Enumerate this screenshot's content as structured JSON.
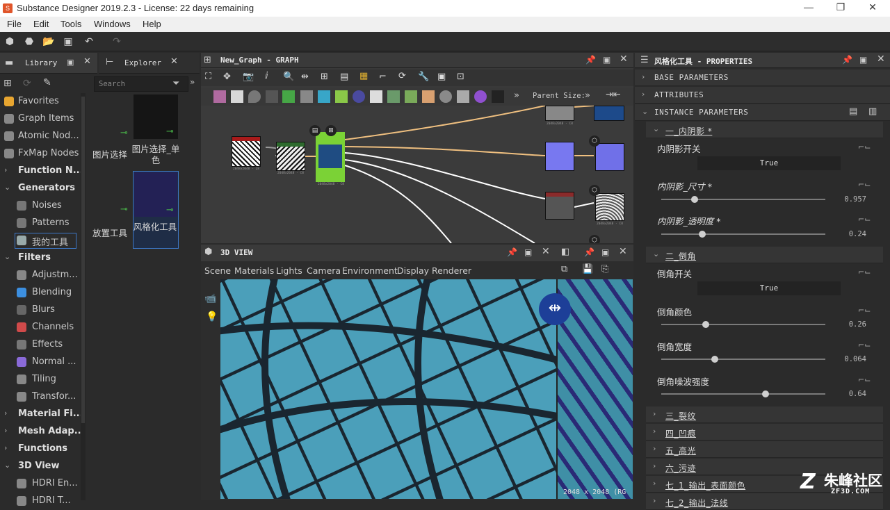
{
  "app": {
    "title": "Substance Designer 2019.2.3 - License: 22 days remaining",
    "menu": [
      "File",
      "Edit",
      "Tools",
      "Windows",
      "Help"
    ]
  },
  "library": {
    "tabs": [
      "Library",
      "Explorer"
    ],
    "search_placeholder": "Search",
    "tree": [
      {
        "label": "Favorites",
        "type": "root",
        "icon": "star-icon",
        "color": "#e8a630"
      },
      {
        "label": "Graph Items",
        "type": "root",
        "icon": "graph-items-icon",
        "color": "#888"
      },
      {
        "label": "Atomic Nod...",
        "type": "root",
        "icon": "atomic-nodes-icon",
        "color": "#888"
      },
      {
        "label": "FxMap Nodes",
        "type": "root",
        "icon": "fxmap-icon",
        "color": "#888"
      },
      {
        "label": "Function N...",
        "type": "section",
        "expanded": false
      },
      {
        "label": "Generators",
        "type": "section",
        "expanded": true
      },
      {
        "label": "Noises",
        "type": "child",
        "icon": "noises-icon",
        "color": "#777"
      },
      {
        "label": "Patterns",
        "type": "child",
        "icon": "patterns-icon",
        "color": "#777"
      },
      {
        "label": "我的工具",
        "type": "child",
        "icon": "my-tools-icon",
        "color": "#9aa",
        "selected": true
      },
      {
        "label": "Filters",
        "type": "section",
        "expanded": true
      },
      {
        "label": "Adjustm...",
        "type": "child",
        "icon": "adjustments-icon",
        "color": "#888"
      },
      {
        "label": "Blending",
        "type": "child",
        "icon": "blending-icon",
        "color": "#3c8fe0"
      },
      {
        "label": "Blurs",
        "type": "child",
        "icon": "blurs-icon",
        "color": "#666"
      },
      {
        "label": "Channels",
        "type": "child",
        "icon": "channels-icon",
        "color": "#d04a4a"
      },
      {
        "label": "Effects",
        "type": "child",
        "icon": "effects-icon",
        "color": "#777"
      },
      {
        "label": "Normal ...",
        "type": "child",
        "icon": "normal-icon",
        "color": "#8a6ad8"
      },
      {
        "label": "Tiling",
        "type": "child",
        "icon": "tiling-icon",
        "color": "#888"
      },
      {
        "label": "Transfor...",
        "type": "child",
        "icon": "transform-icon",
        "color": "#888"
      },
      {
        "label": "Material Fi...",
        "type": "section",
        "expanded": false
      },
      {
        "label": "Mesh Adap...",
        "type": "section",
        "expanded": false
      },
      {
        "label": "Functions",
        "type": "section",
        "expanded": false
      },
      {
        "label": "3D View",
        "type": "section",
        "expanded": true
      },
      {
        "label": "HDRI En...",
        "type": "child",
        "icon": "hdri-icon",
        "color": "#888"
      },
      {
        "label": "HDRI T...",
        "type": "child",
        "icon": "hdri-icon",
        "color": "#888"
      }
    ],
    "items": [
      {
        "label": "图片选择",
        "thumb": "none"
      },
      {
        "label": "图片选择_单色",
        "thumb": "#151515"
      },
      {
        "label": "放置工具",
        "thumb": "none"
      },
      {
        "label": "风格化工具",
        "thumb": "#232155",
        "selected": true
      }
    ]
  },
  "graph": {
    "tab_title": "New_Graph - GRAPH",
    "parent_size_label": "Parent Size:",
    "node_labels": [
      "2048x2048 - L8",
      "2048x2048 - C8",
      "2048x2048 - C8",
      "2048x2048 - C8",
      "2048x2048 - C8"
    ]
  },
  "view3d": {
    "tab_title": "3D VIEW",
    "menu": [
      "Scene",
      "Materials",
      "Lights",
      "Camera",
      "Environment",
      "Display",
      "Renderer"
    ],
    "resolution_text": "2048 x 2048 (RG"
  },
  "properties": {
    "tab_title": "风格化工具 - PROPERTIES",
    "sections": [
      "BASE PARAMETERS",
      "ATTRIBUTES",
      "INSTANCE PARAMETERS"
    ],
    "group1": {
      "title": "一_内阴影 *",
      "bool_label": "内阴影开关",
      "bool_value": "True",
      "size_label": "内阴影_尺寸 *",
      "size_value": "0.957",
      "size_fraction": 0.19,
      "opacity_label": "内阴影_透明度 *",
      "opacity_value": "0.24",
      "opacity_fraction": 0.24
    },
    "group2": {
      "title": "二_倒角",
      "bool_label": "倒角开关",
      "bool_value": "True",
      "color_label": "倒角颜色",
      "color_value": "0.26",
      "color_fraction": 0.26,
      "width_label": "倒角宽度",
      "width_value": "0.064",
      "width_fraction": 0.32,
      "noise_label": "倒角噪波强度",
      "noise_value": "0.64",
      "noise_fraction": 0.64
    },
    "collapsed_groups": [
      "三_裂纹",
      "四_凹痕",
      "五_高光",
      "六_污迹",
      "七_1_输出_表面颜色",
      "七_2_输出_法线"
    ]
  },
  "watermark": {
    "text": "朱峰社区",
    "sub": "ZF3D.COM"
  }
}
